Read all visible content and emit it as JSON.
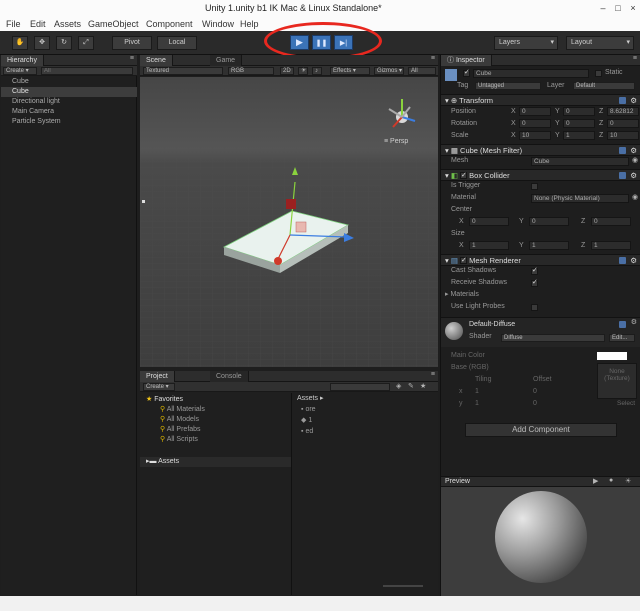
{
  "titlebar": {
    "title": "Unity   1.unity    b1    IK    Mac & Linux Standalone*",
    "minimize": "–",
    "maximize": "□",
    "close": "×"
  },
  "menu": {
    "items": [
      "File",
      "Edit",
      "Assets",
      "GameObject",
      "Component",
      "Window",
      "Help"
    ]
  },
  "toolbar": {
    "pivot_label": "Pivot",
    "local_label": "Local",
    "play_glyph": "▶",
    "pause_glyph": "❚❚",
    "step_glyph": "▶|",
    "layers_label": "Layers",
    "layout_label": "Layout"
  },
  "hierarchy": {
    "tab_label": "Hierarchy",
    "create_label": "Create ▾",
    "search_placeholder": "All",
    "items": [
      {
        "label": "Cube",
        "selected": false
      },
      {
        "label": "Cube",
        "selected": true
      },
      {
        "label": "Directional light",
        "selected": false
      },
      {
        "label": "Main Camera",
        "selected": false
      },
      {
        "label": "Particle System",
        "selected": false
      }
    ]
  },
  "scene": {
    "tab_scene": "Scene",
    "tab_game": "Game",
    "shading": "Textured",
    "render_mode": "RGB",
    "mode_2d": "2D",
    "effects": "Effects ▾",
    "gizmos": "Gizmos ▾",
    "persp_label": "≡ Persp"
  },
  "project": {
    "tab_project": "Project",
    "tab_console": "Console",
    "create_label": "Create ▾",
    "favorites_label": "Favorites",
    "favorites": [
      "All Materials",
      "All Models",
      "All Prefabs",
      "All Scripts"
    ],
    "assets_tree_label": "Assets",
    "assets_header": "Assets ▸",
    "assets": [
      "ore",
      "1",
      "ed"
    ]
  },
  "inspector": {
    "tab_label": "Inspector",
    "object_name": "Cube",
    "static_label": "Static",
    "tag_label": "Tag",
    "tag_value": "Untagged",
    "layer_label": "Layer",
    "layer_value": "Default",
    "transform": {
      "title": "Transform",
      "position_label": "Position",
      "rotation_label": "Rotation",
      "scale_label": "Scale",
      "position": [
        "0",
        "0",
        "8.62812"
      ],
      "rotation": [
        "0",
        "0",
        "0"
      ],
      "scale": [
        "10",
        "1",
        "10"
      ]
    },
    "mesh_filter": {
      "title": "Cube (Mesh Filter)",
      "mesh_label": "Mesh",
      "mesh_value": "Cube"
    },
    "box_collider": {
      "title": "Box Collider",
      "is_trigger_label": "Is Trigger",
      "material_label": "Material",
      "material_value": "None (Physic Material)",
      "center_label": "Center",
      "size_label": "Size",
      "center": [
        "0",
        "0",
        "0"
      ],
      "size": [
        "1",
        "1",
        "1"
      ]
    },
    "mesh_renderer": {
      "title": "Mesh Renderer",
      "cast_shadows_label": "Cast Shadows",
      "receive_shadows_label": "Receive Shadows",
      "materials_label": "Materials",
      "use_light_probes_label": "Use Light Probes"
    },
    "material": {
      "title": "Default-Diffuse",
      "shader_label": "Shader",
      "shader_value": "Diffuse",
      "edit_label": "Edit...",
      "main_color_label": "Main Color",
      "base_label": "Base (RGB)",
      "tiling_label": "Tiling",
      "offset_label": "Offset",
      "x_label": "x",
      "y_label": "y",
      "tiling": [
        "1",
        "1"
      ],
      "offset": [
        "0",
        "0"
      ],
      "none_texture": "None\n(Texture)",
      "select_label": "Select"
    },
    "add_component_label": "Add Component",
    "preview_label": "Preview"
  },
  "colors": {
    "accent_play": "#3b73b8",
    "highlight_ring": "#e8281f",
    "panel_bg": "#1e1e1e"
  }
}
